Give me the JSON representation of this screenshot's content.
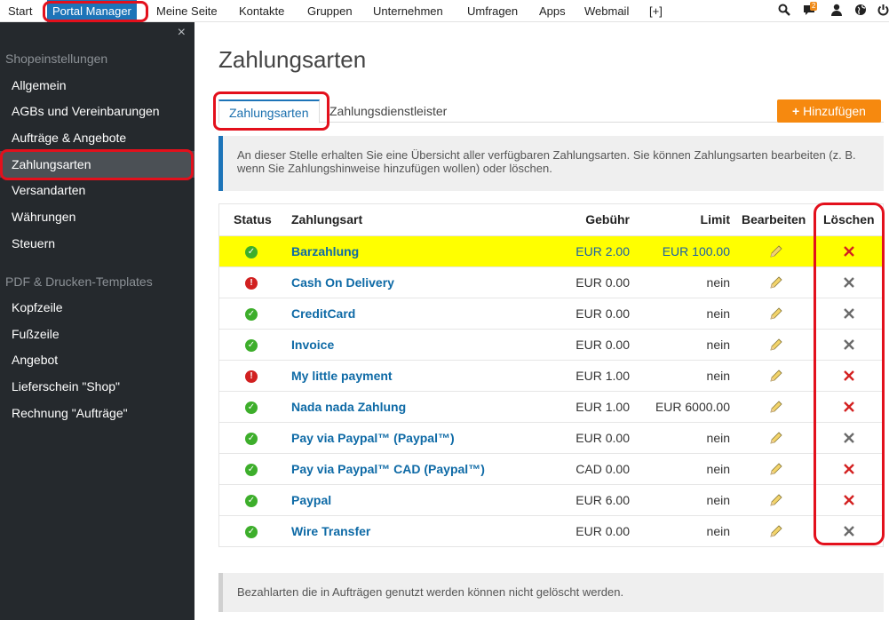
{
  "topnav": {
    "items": [
      "Start",
      "Portal Manager",
      "Meine Seite",
      "Kontakte",
      "Gruppen",
      "Unternehmen",
      "Umfragen",
      "Apps",
      "Webmail",
      "[+]"
    ],
    "active": "Portal Manager",
    "chat_badge": "2",
    "icons": [
      "search-icon",
      "chat-icon",
      "user-icon",
      "globe-icon",
      "power-icon"
    ]
  },
  "sidebar": {
    "close": "×",
    "groups": [
      {
        "title": "Shopeinstellungen",
        "items": [
          "Allgemein",
          "AGBs und Vereinbarungen",
          "Aufträge & Angebote",
          "Zahlungsarten",
          "Versandarten",
          "Währungen",
          "Steuern"
        ]
      },
      {
        "title": "PDF & Drucken-Templates",
        "items": [
          "Kopfzeile",
          "Fußzeile",
          "Angebot",
          "Lieferschein \"Shop\"",
          "Rechnung \"Aufträge\""
        ]
      }
    ],
    "active": "Zahlungsarten"
  },
  "main": {
    "title": "Zahlungsarten",
    "tabs": [
      "Zahlungsarten",
      "Zahlungsdienstleister"
    ],
    "add_button": "Hinzufügen",
    "add_icon": "plus-icon",
    "info": "An dieser Stelle erhalten Sie eine Übersicht aller verfügbaren Zahlungsarten. Sie können Zahlungsarten bearbeiten (z. B. wenn Sie Zahlungshinweise hinzufügen wollen) oder löschen.",
    "table": {
      "headers": [
        "Status",
        "Zahlungsart",
        "Gebühr",
        "Limit",
        "Bearbeiten",
        "Löschen"
      ],
      "rows": [
        {
          "status": "ok",
          "name": "Barzahlung",
          "fee": "EUR 2.00",
          "limit": "EUR 100.00",
          "delete": "red"
        },
        {
          "status": "error",
          "name": "Cash On Delivery",
          "fee": "EUR 0.00",
          "limit": "nein",
          "delete": "grey"
        },
        {
          "status": "ok",
          "name": "CreditCard",
          "fee": "EUR 0.00",
          "limit": "nein",
          "delete": "grey"
        },
        {
          "status": "ok",
          "name": "Invoice",
          "fee": "EUR 0.00",
          "limit": "nein",
          "delete": "grey"
        },
        {
          "status": "error",
          "name": "My little payment",
          "fee": "EUR 1.00",
          "limit": "nein",
          "delete": "red"
        },
        {
          "status": "ok",
          "name": "Nada nada Zahlung",
          "fee": "EUR 1.00",
          "limit": "EUR 6000.00",
          "delete": "red"
        },
        {
          "status": "ok",
          "name": "Pay via Paypal™ (Paypal™)",
          "fee": "EUR 0.00",
          "limit": "nein",
          "delete": "grey"
        },
        {
          "status": "ok",
          "name": "Pay via Paypal™ CAD (Paypal™)",
          "fee": "CAD 0.00",
          "limit": "nein",
          "delete": "red"
        },
        {
          "status": "ok",
          "name": "Paypal",
          "fee": "EUR 6.00",
          "limit": "nein",
          "delete": "red"
        },
        {
          "status": "ok",
          "name": "Wire Transfer",
          "fee": "EUR 0.00",
          "limit": "nein",
          "delete": "grey"
        }
      ],
      "highlighted_row": "Barzahlung"
    },
    "footer_note": "Bezahlarten die in Aufträgen genutzt werden können nicht gelöscht werden."
  },
  "colors": {
    "accent": "#1d74b8",
    "add_button": "#f6890f",
    "sidebar_bg": "#25292d",
    "highlight_row": "#ffff00",
    "annotation": "#e3101c",
    "status_ok": "#3dae2b",
    "status_error": "#d12020"
  }
}
